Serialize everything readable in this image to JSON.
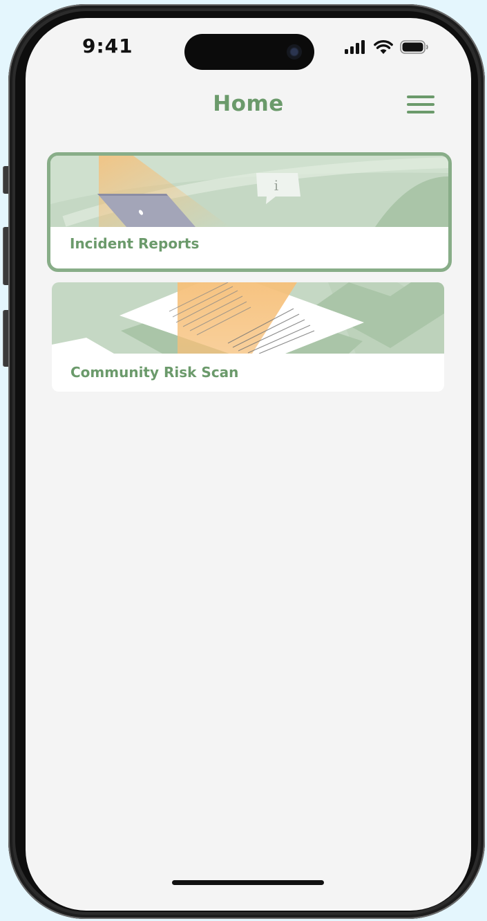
{
  "status_bar": {
    "time": "9:41",
    "icons": [
      "cellular-signal-icon",
      "wifi-icon",
      "battery-icon"
    ]
  },
  "header": {
    "title": "Home",
    "menu_icon": "hamburger-menu-icon"
  },
  "cards": [
    {
      "label": "Incident Reports",
      "selected": true,
      "illustration": "laptop-info-bubble-illustration"
    },
    {
      "label": "Community Risk Scan",
      "selected": false,
      "illustration": "document-scan-illustration"
    }
  ],
  "colors": {
    "accent_green": "#6b9a6b",
    "selected_border": "#88ad88",
    "banner_green": "#c5d8c4",
    "banner_dark_green": "#aac5a8",
    "scan_orange": "#f6c07a",
    "screen_background": "#f4f4f4",
    "outer_background": "#e4f6fd"
  }
}
